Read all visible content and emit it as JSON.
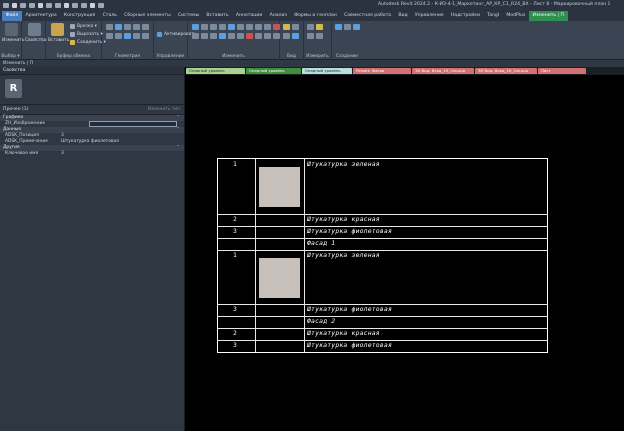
{
  "window": {
    "title": "Autodesk Revit 2024.2 - К-ИЗ-4-1_Маркетинг_АР_КР_С1_R24_ВХ - Лист 8 - Маркировочный план 1"
  },
  "ribbon_tabs": [
    "Файл",
    "Архитектура",
    "Конструкция",
    "Сталь",
    "Сборные элементы",
    "Системы",
    "Вставить",
    "Аннотации",
    "Анализ",
    "Формы и генплан",
    "Совместная работа",
    "Вид",
    "Управление",
    "Надстройки",
    "Tangl",
    "ModPlus",
    "Изменить | П"
  ],
  "ribbon_panels": {
    "select": {
      "button": "Изменить",
      "title": "Выбор ▾"
    },
    "properties": {
      "button": "Свойства",
      "title": ""
    },
    "clipboard": {
      "paste": "Вставить",
      "title": "Буфер обмена",
      "items": [
        "Врезка ▾",
        "Вырезать ▾",
        "Соединить ▾"
      ]
    },
    "geometry": {
      "title": "Геометрия",
      "activate": "Активировать"
    },
    "manage": {
      "title": "Управление"
    },
    "modify": {
      "title": "Изменить"
    },
    "view": {
      "title": "Вид"
    },
    "measure": {
      "title": "Измерить"
    },
    "create": {
      "title": "Создание"
    }
  },
  "options_bar": {
    "text": "Изменить | П"
  },
  "properties_panel": {
    "title": "Свойства",
    "type_filter": "Прочее (1)",
    "edit_type_label": "Изменить тип",
    "categories": [
      {
        "name": "Графика",
        "rows": [
          {
            "name": "ZH_Изображение",
            "value": ""
          }
        ]
      },
      {
        "name": "Данные",
        "rows": [
          {
            "name": "ADSK_Позиция",
            "value": "3"
          },
          {
            "name": "ADSK_Примечание",
            "value": "Штукатурка фиолетовая"
          }
        ]
      },
      {
        "name": "Другие",
        "rows": [
          {
            "name": "Ключевое имя",
            "value": "3"
          }
        ]
      }
    ]
  },
  "sheet_tabs": [
    {
      "label": "Опорный уровень",
      "bg": "#a9d18e",
      "fg": "#1e2a14"
    },
    {
      "label": "Опорный уровень",
      "bg": "#3f8f3a",
      "fg": "#ffffff"
    },
    {
      "label": "Опорный уровень",
      "bg": "#b8dede",
      "fg": "#1e2a2a"
    },
    {
      "label": "Разрез: Фасад",
      "bg": "#d07070",
      "fg": "#ffffff"
    },
    {
      "label": "3D Вид: Вход_1К_Секция",
      "bg": "#d07070",
      "fg": "#ffffff"
    },
    {
      "label": "3D Вид: Вход_1К_Секция",
      "bg": "#d07070",
      "fg": "#ffffff"
    },
    {
      "label": "Лист",
      "bg": "#d07070",
      "fg": "#ffffff"
    }
  ],
  "schedule": {
    "rows": [
      {
        "num": "1",
        "name": "Штукатурка зеленая",
        "swatch": true
      },
      {
        "num": "2",
        "name": "Штукатурка красная"
      },
      {
        "num": "3",
        "name": "Штукатурка фиолетовая"
      },
      {
        "header": "Фасад 1"
      },
      {
        "num": "1",
        "name": "Штукатурка зеленая",
        "swatch": true
      },
      {
        "num": "3",
        "name": "Штукатурка фиолетовая"
      },
      {
        "header": "Фасад 2"
      },
      {
        "num": "2",
        "name": "Штукатурка красная"
      },
      {
        "num": "3",
        "name": "Штукатурка фиолетовая"
      }
    ]
  }
}
